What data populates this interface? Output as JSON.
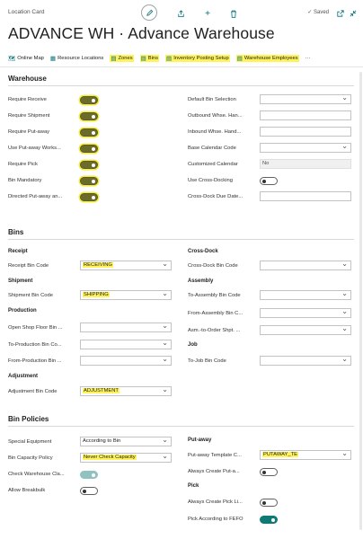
{
  "header": {
    "breadcrumb": "Location Card",
    "saved": "Saved",
    "title": "ADVANCE WH · Advance Warehouse"
  },
  "actions": [
    {
      "label": "Online Map",
      "icon": "map-icon"
    },
    {
      "label": "Resource Locations",
      "icon": "resources-icon"
    },
    {
      "label": "Zones",
      "icon": "zones-icon"
    },
    {
      "label": "Bins",
      "icon": "bins-icon"
    },
    {
      "label": "Inventory Posting Setup",
      "icon": "setup-icon"
    },
    {
      "label": "Warehouse Employees",
      "icon": "employees-icon"
    },
    {
      "label": "···",
      "icon": "more-icon"
    }
  ],
  "warehouse": {
    "heading": "Warehouse",
    "left": [
      {
        "label": "Require Receive",
        "on": true
      },
      {
        "label": "Require Shipment",
        "on": true
      },
      {
        "label": "Require Put-away",
        "on": true
      },
      {
        "label": "Use Put-away Works...",
        "on": true
      },
      {
        "label": "Require Pick",
        "on": true
      },
      {
        "label": "Bin Mandatory",
        "on": true
      },
      {
        "label": "Directed Put-away an...",
        "on": true
      }
    ],
    "right": {
      "default_bin_selection": "Default Bin Selection",
      "outbound": "Outbound Whse. Han...",
      "inbound": "Inbound Whse. Hand...",
      "base_calendar": "Base Calendar Code",
      "customized_calendar": "Customized Calendar",
      "customized_calendar_value": "No",
      "use_cross_docking": "Use Cross-Docking",
      "cross_dock_due_date": "Cross-Dock Due Date..."
    }
  },
  "bins": {
    "heading": "Bins",
    "receipt_h": "Receipt",
    "receipt_label": "Receipt Bin Code",
    "receipt_value": "RECEIVING",
    "shipment_h": "Shipment",
    "shipment_label": "Shipment Bin Code",
    "shipment_value": "SHIPPING",
    "production_h": "Production",
    "open_shop": "Open Shop Floor Bin ...",
    "to_production": "To-Production Bin Co...",
    "from_production": "From-Production Bin ...",
    "adjustment_h": "Adjustment",
    "adjustment_label": "Adjustment Bin Code",
    "adjustment_value": "ADJUSTMENT",
    "cross_dock_h": "Cross-Dock",
    "cross_dock_label": "Cross-Dock Bin Code",
    "assembly_h": "Assembly",
    "to_assembly": "To-Assembly Bin Code",
    "from_assembly": "From-Assembly Bin C...",
    "asm_to_order": "Asm.-to-Order Shpt. ...",
    "job_h": "Job",
    "to_job": "To-Job Bin Code"
  },
  "bin_policies": {
    "heading": "Bin Policies",
    "special_equipment": "Special Equipment",
    "special_equipment_value": "According to Bin",
    "bin_capacity": "Bin Capacity Policy",
    "bin_capacity_value": "Never Check Capacity",
    "check_warehouse": "Check Warehouse Cla...",
    "allow_breakbulk": "Allow Breakbulk",
    "putaway_h": "Put-away",
    "putaway_template": "Put-away Template C...",
    "putaway_template_value": "PUTAWAY_TE",
    "always_create_putaway": "Always Create Put-a...",
    "pick_h": "Pick",
    "always_create_pick": "Always Create Pick Li...",
    "pick_fefo": "Pick According to FEFO"
  }
}
